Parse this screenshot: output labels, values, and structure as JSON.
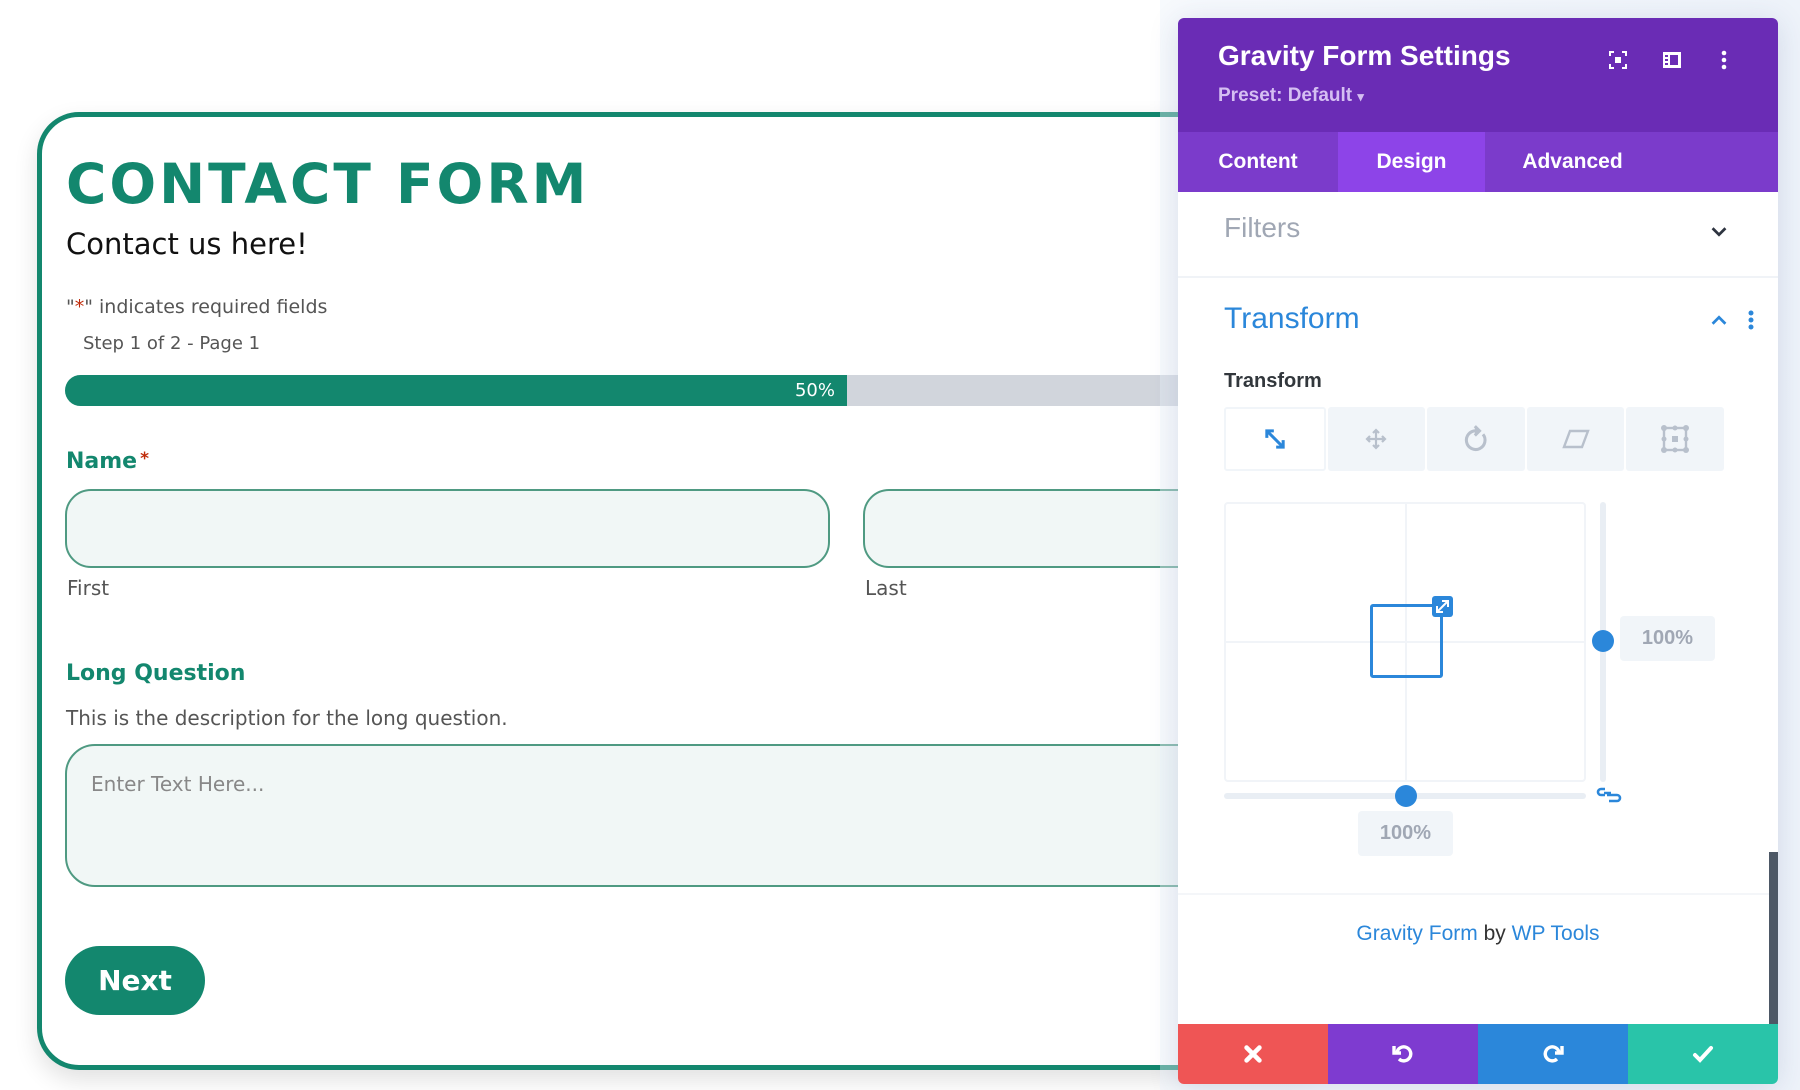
{
  "form": {
    "title": "CONTACT FORM",
    "subtitle": "Contact us here!",
    "required_note_quote_open": "\"",
    "required_note_asterisk": "*",
    "required_note_rest": "\" indicates required fields",
    "step": "Step 1 of 2 - Page 1",
    "progress": {
      "percent": 50,
      "label": "50%"
    },
    "name_field": {
      "label": "Name",
      "required_mark": "*",
      "first_sublabel": "First",
      "last_sublabel": "Last",
      "first_value": "",
      "last_value": ""
    },
    "long_question": {
      "label": "Long Question",
      "description": "This is the description for the long question.",
      "placeholder": "Enter Text Here..."
    },
    "next_button": "Next",
    "colors": {
      "brand": "#13876e",
      "required": "#c02b0a"
    }
  },
  "panel": {
    "title": "Gravity Form Settings",
    "preset": "Preset: Default",
    "preset_caret": "▾",
    "header_icons": [
      "focus-icon",
      "split-view-icon",
      "more-options-icon"
    ],
    "tabs": [
      {
        "label": "Content",
        "active": false
      },
      {
        "label": "Design",
        "active": true
      },
      {
        "label": "Advanced",
        "active": false
      }
    ],
    "filters_label": "Filters",
    "transform_section_title": "Transform",
    "transform_control_label": "Transform",
    "transform_tools": [
      {
        "name": "scale",
        "active": true
      },
      {
        "name": "translate",
        "active": false
      },
      {
        "name": "rotate",
        "active": false
      },
      {
        "name": "skew",
        "active": false
      },
      {
        "name": "origin",
        "active": false
      }
    ],
    "scale_y": "100%",
    "scale_x": "100%",
    "credit": {
      "plugin": "Gravity Form",
      "by": " by ",
      "author": "WP Tools"
    },
    "actions": [
      "cancel",
      "undo",
      "redo",
      "save"
    ],
    "colors": {
      "header": "#6a2cb5",
      "tabs": "#7b3bcb",
      "active_tab": "#8d44e8",
      "accent": "#2b87da",
      "cancel": "#ef5555",
      "undo": "#7e3bd0",
      "redo": "#2b87da",
      "save": "#29c4a9"
    }
  }
}
